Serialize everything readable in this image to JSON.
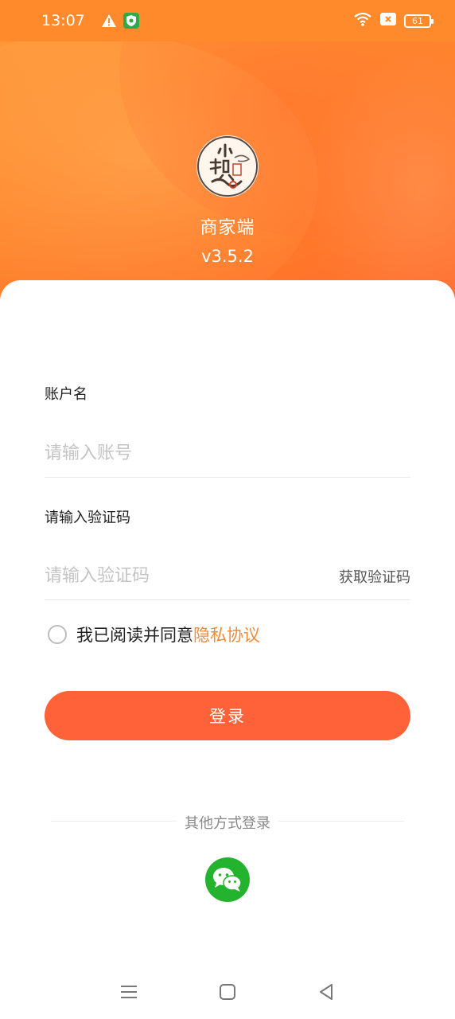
{
  "status_bar": {
    "time": "13:07",
    "battery": "61",
    "icons": [
      "warning-icon",
      "shield-app-icon",
      "wifi-icon",
      "close-box-icon",
      "battery-icon"
    ]
  },
  "app": {
    "name": "商家端",
    "version": "v3.5.2",
    "logo_text": "小镇"
  },
  "form": {
    "account_label": "账户名",
    "account_placeholder": "请输入账号",
    "code_label": "请输入验证码",
    "code_placeholder": "请输入验证码",
    "get_code": "获取验证码",
    "agree_text": "我已阅读并同意",
    "privacy_link": "隐私协议",
    "agreed": false
  },
  "login_button": "登录",
  "other_login": {
    "label": "其他方式登录",
    "methods": [
      "wechat-icon"
    ]
  },
  "nav": {
    "buttons": [
      "menu-icon",
      "home-square-icon",
      "back-triangle-icon"
    ]
  },
  "colors": {
    "header_orange": "#ff8a2b",
    "button_orange": "#ff6238",
    "link_orange": "#f08a38",
    "wechat_green": "#23b32f"
  }
}
